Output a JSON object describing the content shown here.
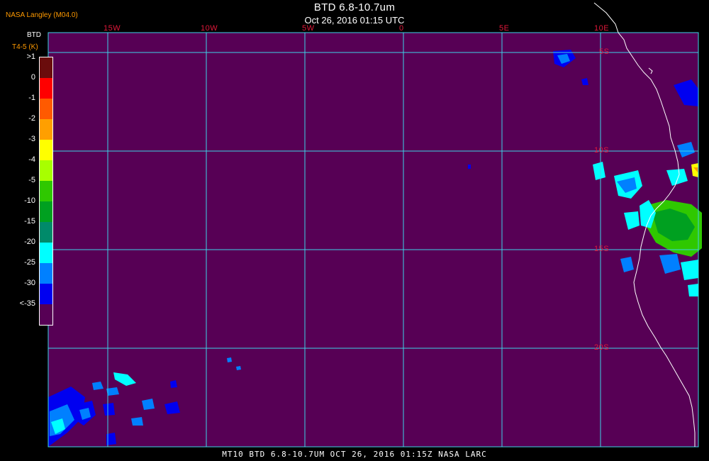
{
  "header": {
    "title": "BTD 6.8-10.7um",
    "subtitle": "Oct 26, 2016 01:15 UTC",
    "logo_text": "NASA Langley (M04.0)"
  },
  "footer": {
    "text": "MT10  BTD 6.8-10.7UM   OCT 26, 2016 01:15Z   NASA LARC"
  },
  "legend": {
    "title": "BTD",
    "subtitle": "T4-5 (K)",
    "entries": [
      {
        "label": ">1",
        "color": "#6a0c0c"
      },
      {
        "label": "0",
        "color": "#ff0000"
      },
      {
        "label": "-1",
        "color": "#ff5a00"
      },
      {
        "label": "-2",
        "color": "#ff9f00"
      },
      {
        "label": "-3",
        "color": "#ffff00"
      },
      {
        "label": "-4",
        "color": "#a8ff00"
      },
      {
        "label": "-5",
        "color": "#2fc800"
      },
      {
        "label": "-10",
        "color": "#00a020"
      },
      {
        "label": "-15",
        "color": "#008a6a"
      },
      {
        "label": "-20",
        "color": "#00ffff"
      },
      {
        "label": "-25",
        "color": "#0080ff"
      },
      {
        "label": "-30",
        "color": "#0000f0"
      },
      {
        "label": "<-35",
        "color": "#570055"
      }
    ]
  },
  "grid": {
    "lon_labels": [
      "15W",
      "10W",
      "5W",
      "0",
      "5E",
      "10E"
    ],
    "lat_labels": [
      "5S",
      "10S",
      "15S",
      "20S"
    ],
    "line_color": "#3cd3e6",
    "label_color": "#e0183a"
  },
  "colors": {
    "background": "#570055",
    "coastline": "#ffffff"
  }
}
